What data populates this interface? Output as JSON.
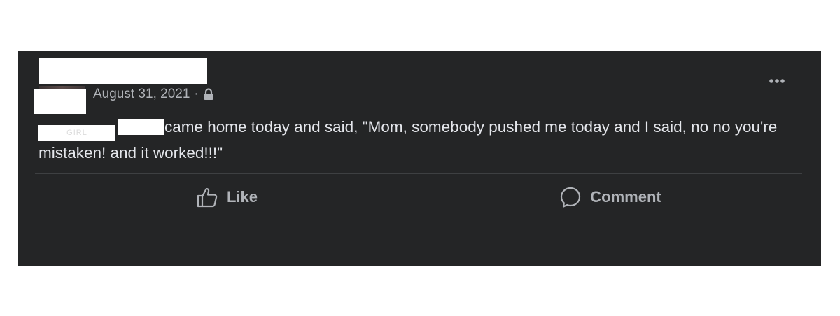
{
  "post": {
    "date": "August 31, 2021",
    "separator": "·",
    "privacy_icon": "lock-icon",
    "more_icon": "more-options-icon",
    "redacted_tag": "GIRL",
    "text": "came home today and said, \"Mom, somebody pushed me today and I said, no no you're mistaken!  and it worked!!!\""
  },
  "actions": {
    "like_label": "Like",
    "like_icon": "thumbs-up-icon",
    "comment_label": "Comment",
    "comment_icon": "comment-bubble-icon"
  },
  "colors": {
    "card_background": "#242526",
    "primary_text": "#e4e6eb",
    "secondary_text": "#b0b3b8",
    "divider": "#3e4042",
    "redaction": "#ffffff"
  }
}
